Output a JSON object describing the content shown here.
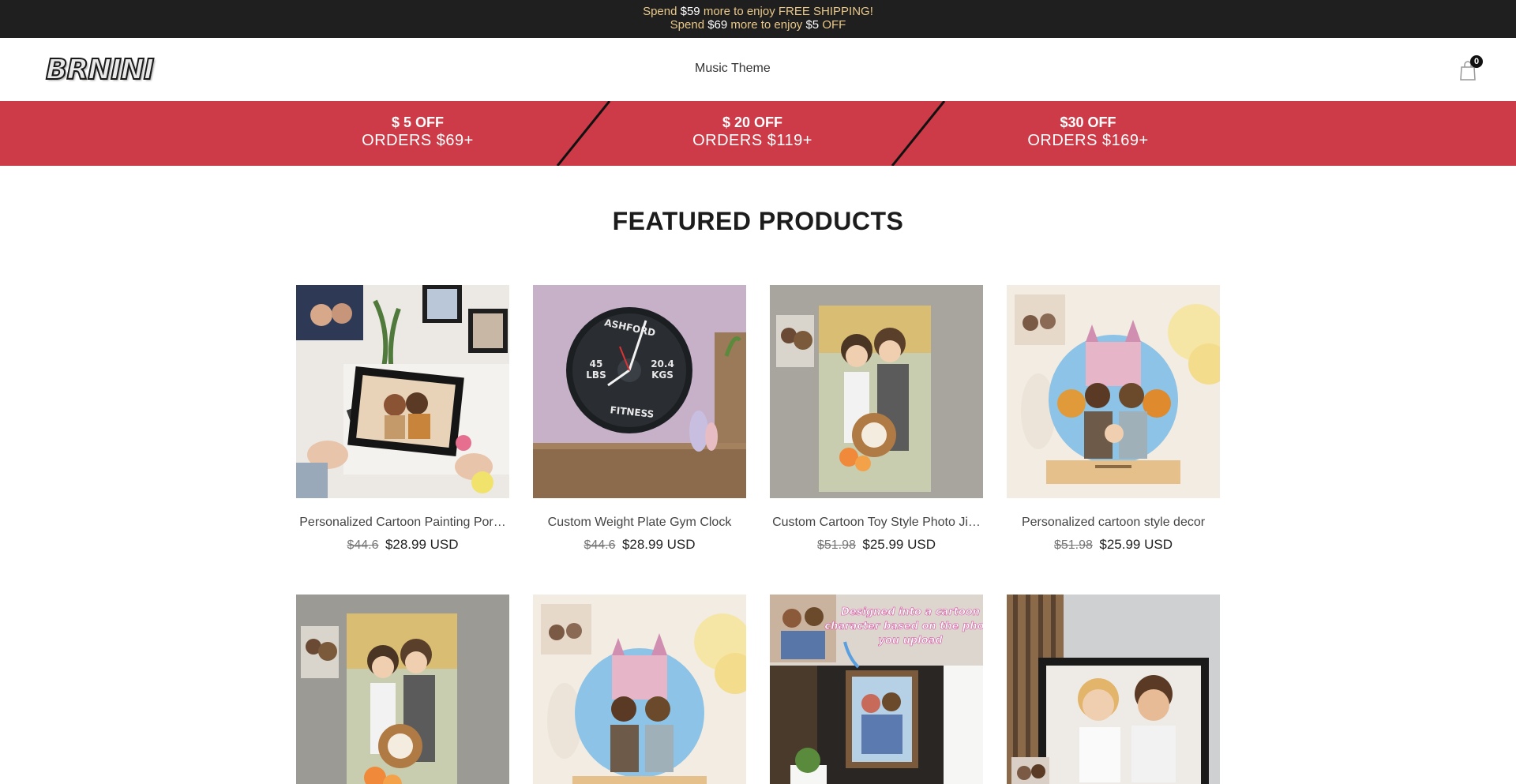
{
  "announcement": {
    "line1": {
      "pre": "Spend ",
      "amount": "$59",
      "post": " more to enjoy FREE SHIPPING!"
    },
    "line2": {
      "pre": "Spend ",
      "amount": "$69",
      "mid": " more to enjoy ",
      "amount2": "$5",
      "post": " OFF"
    }
  },
  "header": {
    "logo_text": "BRNINI",
    "nav": [
      "Music Theme"
    ],
    "cart_count": "0",
    "cart_icon": "shopping-bag-icon"
  },
  "promo": [
    {
      "line1": "$ 5 OFF",
      "line2": "ORDERS $69+"
    },
    {
      "line1": "$ 20 OFF",
      "line2": "ORDERS $119+"
    },
    {
      "line1": "$30 OFF",
      "line2": "ORDERS $169+"
    }
  ],
  "featured": {
    "title": "FEATURED PRODUCTS",
    "products": [
      {
        "name": "Personalized Cartoon Painting Por…",
        "compare_price": "$44.6",
        "price": "$28.99 USD"
      },
      {
        "name": "Custom Weight Plate Gym Clock",
        "compare_price": "$44.6",
        "price": "$28.99 USD",
        "clock_top": "ASHFORD",
        "clock_bottom": "FITNESS",
        "clock_left_num": "45",
        "clock_left_unit": "LBS",
        "clock_right_num": "20.4",
        "clock_right_unit": "KGS"
      },
      {
        "name": "Custom Cartoon Toy Style Photo Ji…",
        "compare_price": "$51.98",
        "price": "$25.99 USD"
      },
      {
        "name": "Personalized cartoon style decor",
        "compare_price": "$51.98",
        "price": "$25.99 USD"
      },
      {
        "name": "",
        "compare_price": "",
        "price": ""
      },
      {
        "name": "",
        "compare_price": "",
        "price": ""
      },
      {
        "name": "",
        "compare_price": "",
        "price": "",
        "overlay_text": "Designed into a cartoon character based on the photo you upload"
      },
      {
        "name": "",
        "compare_price": "",
        "price": ""
      }
    ]
  },
  "colors": {
    "announcement_bg": "#1f1f1f",
    "announcement_text": "#e9c889",
    "promo_bg": "#cc3b47"
  }
}
